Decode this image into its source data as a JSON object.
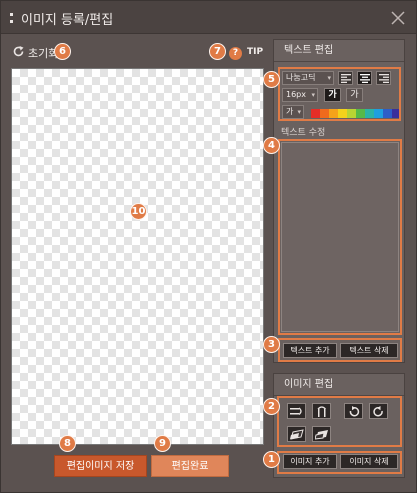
{
  "window": {
    "title": "이미지 등록/편집"
  },
  "toolbar": {
    "reset_label": "초기화",
    "tip_label": "TIP",
    "help_glyph": "?"
  },
  "text_panel": {
    "heading": "텍스트 편집",
    "font_family": "나눔고딕",
    "font_size": "16px",
    "bold_glyph": "가",
    "normal_glyph": "가",
    "color_glyph": "가",
    "palette": [
      "#e52d27",
      "#f06a1d",
      "#f5a31a",
      "#f4d21b",
      "#b8d433",
      "#56b947",
      "#2bb3a6",
      "#1e9fe0",
      "#2d5ec8",
      "#3a2f9c"
    ],
    "edit_label": "텍스트 수정",
    "add_text_label": "텍스트 추가",
    "delete_text_label": "텍스트 삭제"
  },
  "image_panel": {
    "heading": "이미지 편집",
    "add_image_label": "이미지 추가",
    "delete_image_label": "이미지 삭제"
  },
  "footer": {
    "save_label": "편집이미지 저장",
    "done_label": "편집완료"
  },
  "badges": {
    "b1": "1",
    "b2": "2",
    "b3": "3",
    "b4": "4",
    "b5": "5",
    "b6": "6",
    "b7": "7",
    "b8": "8",
    "b9": "9",
    "b10": "10"
  },
  "colors": {
    "accent": "#e07b46",
    "save_button": "#c8582c",
    "done_button": "#e0865a"
  }
}
